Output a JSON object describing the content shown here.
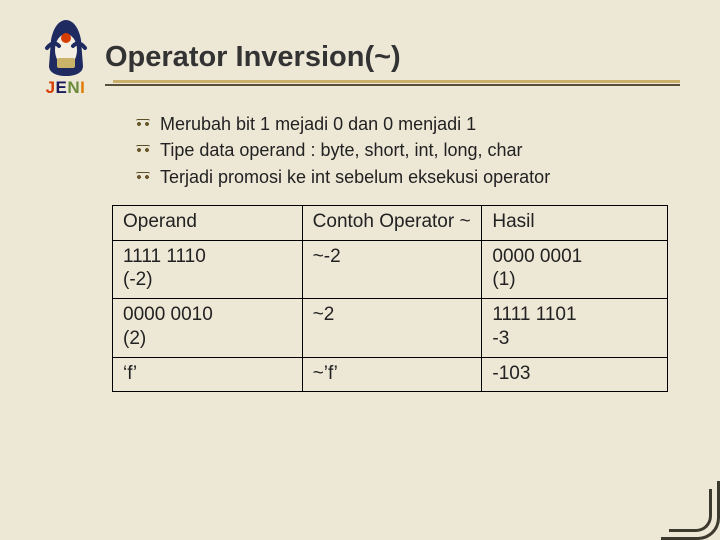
{
  "brand": {
    "l1": "J",
    "l2": "E",
    "l3": "N",
    "l4": "I"
  },
  "title": "Operator Inversion(~)",
  "bullets": [
    "Merubah bit 1 mejadi 0 dan 0 menjadi 1",
    "Tipe data operand : byte, short, int, long, char",
    "Terjadi promosi ke int sebelum eksekusi operator"
  ],
  "table": {
    "headers": [
      "Operand",
      "Contoh Operator ~",
      "Hasil"
    ],
    "rows": [
      {
        "operand_a": "1111 1110",
        "operand_b": "(-2)",
        "example": "~-2",
        "result_a": "0000 0001",
        "result_b": "(1)"
      },
      {
        "operand_a": "0000 0010",
        "operand_b": "(2)",
        "example": "~2",
        "result_a": "1111 1101",
        "result_b": "-3"
      },
      {
        "operand_a": "‘f’",
        "example": "~’f’",
        "result_a": "-103"
      }
    ]
  }
}
